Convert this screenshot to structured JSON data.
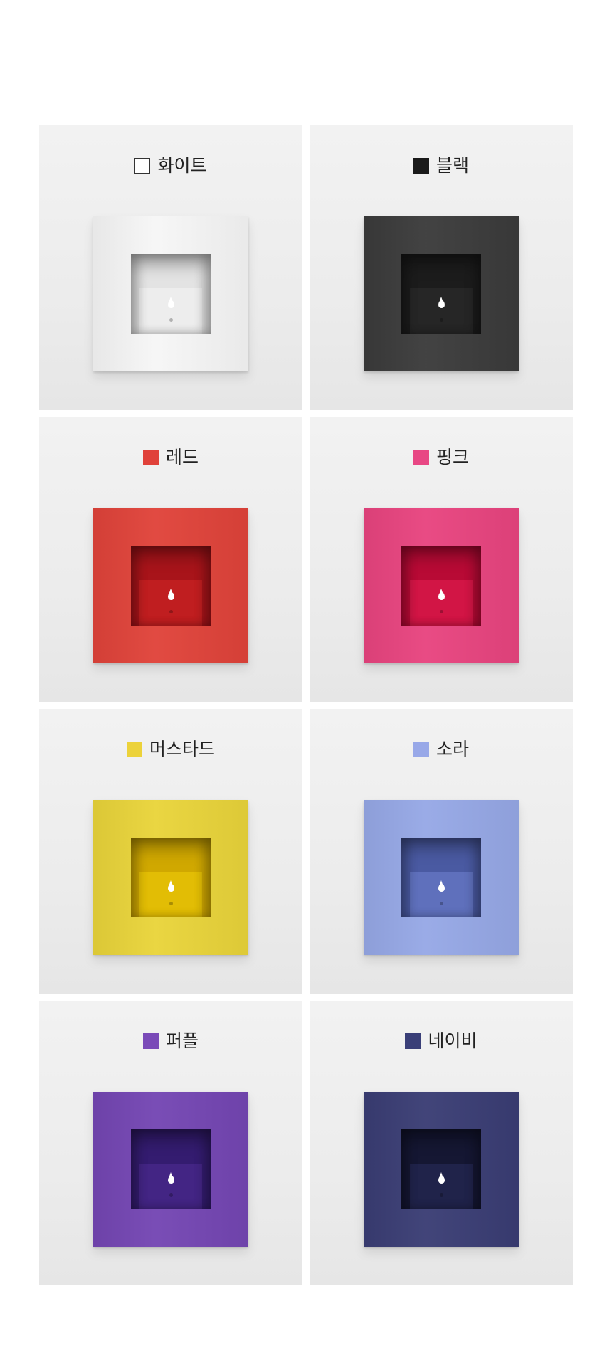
{
  "colors": [
    {
      "label": "화이트",
      "swatch": "#ffffff",
      "outlined": true,
      "frame": "#f6f6f6",
      "inner": "#e3e3e3",
      "back": "#ededed"
    },
    {
      "label": "블랙",
      "swatch": "#1a1a1a",
      "outlined": false,
      "frame": "#3b3b3b",
      "inner": "#1c1c1c",
      "back": "#262626"
    },
    {
      "label": "레드",
      "swatch": "#e0413a",
      "outlined": false,
      "frame": "#e0433a",
      "inner": "#a8141a",
      "back": "#c01e20"
    },
    {
      "label": "핑크",
      "swatch": "#e84784",
      "outlined": false,
      "frame": "#e8447f",
      "inner": "#b80a35",
      "back": "#d21545"
    },
    {
      "label": "머스타드",
      "swatch": "#ecd23a",
      "outlined": false,
      "frame": "#e9d43a",
      "inner": "#d0a800",
      "back": "#e2bd05"
    },
    {
      "label": "소라",
      "swatch": "#98a8e8",
      "outlined": false,
      "frame": "#96a8e6",
      "inner": "#4a5aa2",
      "back": "#5f70bc"
    },
    {
      "label": "퍼플",
      "swatch": "#7a4ab8",
      "outlined": false,
      "frame": "#7446b3",
      "inner": "#341c70",
      "back": "#432584"
    },
    {
      "label": "네이비",
      "swatch": "#3a3f78",
      "outlined": false,
      "frame": "#3a3d74",
      "inner": "#151733",
      "back": "#20234a"
    }
  ]
}
